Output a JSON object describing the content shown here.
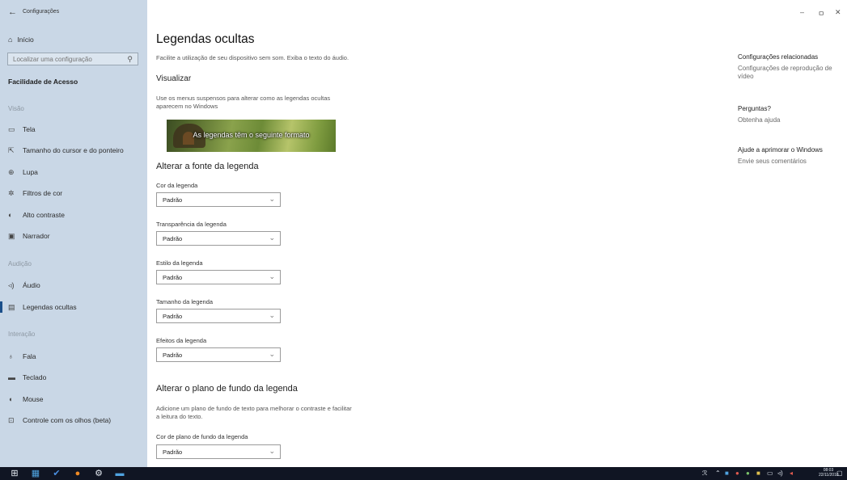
{
  "window": {
    "title": "Configurações",
    "back": "←",
    "minimize": "–",
    "restore": "ㅁ",
    "close": "✕"
  },
  "sidebar": {
    "home_label": "Início",
    "search_placeholder": "Localizar uma configuração",
    "section_title": "Facilidade de Acesso",
    "groups": [
      {
        "label": "Visão",
        "items": [
          "Tela",
          "Tamanho do cursor e do ponteiro",
          "Lupa",
          "Filtros de cor",
          "Alto contraste",
          "Narrador"
        ]
      },
      {
        "label": "Audição",
        "items": [
          "Áudio",
          "Legendas ocultas"
        ]
      },
      {
        "label": "Interação",
        "items": [
          "Fala",
          "Teclado",
          "Mouse",
          "Controle com os olhos (beta)"
        ]
      }
    ],
    "active_item": "Legendas ocultas"
  },
  "main": {
    "title": "Legendas ocultas",
    "intro": "Facilite a utilização de seu dispositivo sem som. Exiba o texto do áudio.",
    "preview": {
      "heading": "Visualizar",
      "description": "Use os menus suspensos para alterar como as legendas ocultas aparecem no Windows",
      "sample_text": "As legendas têm o seguinte formato"
    },
    "font_section": {
      "heading": "Alterar a fonte da legenda",
      "fields": [
        {
          "label": "Cor da legenda",
          "value": "Padrão"
        },
        {
          "label": "Transparência da legenda",
          "value": "Padrão"
        },
        {
          "label": "Estilo da legenda",
          "value": "Padrão"
        },
        {
          "label": "Tamanho da legenda",
          "value": "Padrão"
        },
        {
          "label": "Efeitos da legenda",
          "value": "Padrão"
        }
      ]
    },
    "background_section": {
      "heading": "Alterar o plano de fundo da legenda",
      "description": "Adicione um plano de fundo de texto para melhorar o contraste e facilitar a leitura do texto.",
      "fields": [
        {
          "label": "Cor de plano de fundo da legenda",
          "value": "Padrão"
        }
      ]
    }
  },
  "related": {
    "blocks": [
      {
        "heading": "Configurações relacionadas",
        "link": "Configurações de reprodução de vídeo"
      },
      {
        "heading": "Perguntas?",
        "link": "Obtenha ajuda"
      },
      {
        "heading": "Ajude a aprimorar o Windows",
        "link": "Envie seus comentários"
      }
    ]
  },
  "taskbar": {
    "time": "08:03",
    "date": "22/11/2018"
  },
  "colors": {
    "sidebar_bg": "#c9d7e6",
    "accent": "#1b4f8a",
    "taskbar_bg": "#101523"
  }
}
